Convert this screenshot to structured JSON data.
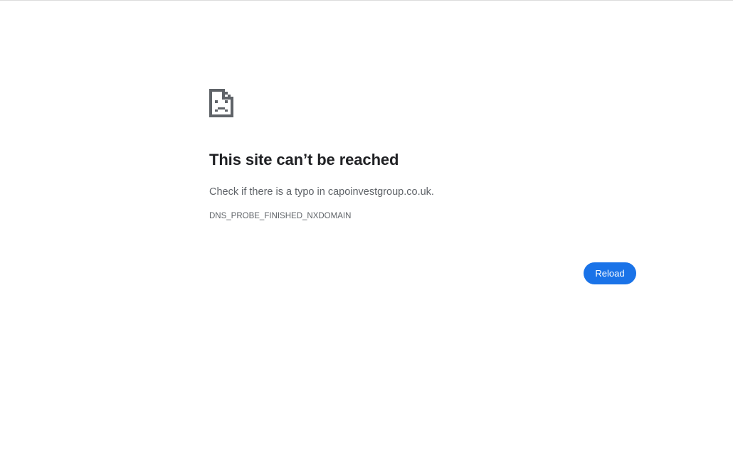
{
  "error_page": {
    "icon": "sad-document-icon",
    "heading": "This site can’t be reached",
    "suggestion": "Check if there is a typo in capoinvestgroup.co.uk.",
    "error_code": "DNS_PROBE_FINISHED_NXDOMAIN",
    "reload_label": "Reload"
  },
  "colors": {
    "background": "#ffffff",
    "heading": "#202124",
    "body_text": "#5f6368",
    "icon": "#5f6368",
    "button_bg": "#1a73e8",
    "button_text": "#ffffff"
  }
}
